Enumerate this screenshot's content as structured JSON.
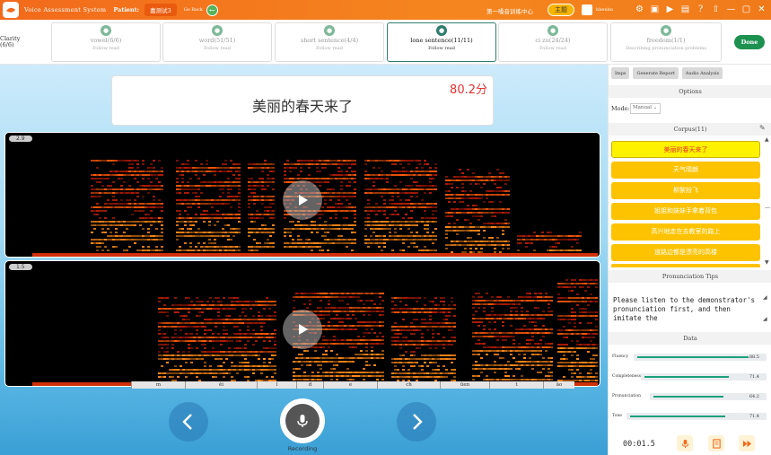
{
  "titlebar": {
    "app_title": "Voice Assessment System",
    "patient_label": "Patient:",
    "patient_name": "嘉测试3",
    "go_back": "Go Back",
    "center_name": "第一嗓音训练中心",
    "theme_button": "主题",
    "username": "bbenbu"
  },
  "clarity": {
    "label": "Clarity",
    "value": "(6/6)"
  },
  "tabs": [
    {
      "label": "vowel(6/6)",
      "sub": "Follow read"
    },
    {
      "label": "word(51/51)",
      "sub": "Follow read"
    },
    {
      "label": "short sentence(4/4)",
      "sub": "Follow read"
    },
    {
      "label": "lone sentence(11/11)",
      "sub": "Follow read"
    },
    {
      "label": "ci zu(24/24)",
      "sub": "Follow read"
    },
    {
      "label": "freedom(1/1)",
      "sub": "Describing pronunciation problems"
    }
  ],
  "done_button": "Done",
  "sentence": {
    "text": "美丽的春天来了",
    "score": "80.2分"
  },
  "spectrograms": [
    {
      "label": "2.9"
    },
    {
      "label": "1.5"
    }
  ],
  "phonemes": [
    "m",
    "ěi",
    "l",
    "d",
    "e",
    "ch",
    "ūen",
    "t",
    "āo"
  ],
  "recording_label": "Recording",
  "right_panel": {
    "buttons": [
      "Imps",
      "Generate Report",
      "Audio Analysis"
    ],
    "options_title": "Options",
    "mode_label": "Mode:",
    "mode_value": "Manual",
    "corpus_title": "Corpus(11)",
    "corpus_items": [
      "美丽的春天来了",
      "天气晴朗",
      "柳絮纷飞",
      "姐姐和妹妹手拿着背包",
      "高兴地走在去教室的路上",
      "道路边都是漂亮的高楼"
    ],
    "tips_title": "Pronunciation Tips",
    "tips_text": "Please listen to the demonstrator's pronunciation first, and then imitate the",
    "data_title": "Data",
    "metrics": [
      {
        "label": "Fluency",
        "value": "88.5",
        "level": 0.885
      },
      {
        "label": "Completeness",
        "value": "71.4",
        "level": 0.714
      },
      {
        "label": "Pronunciation",
        "value": "64.2",
        "level": 0.642
      },
      {
        "label": "Tone",
        "value": "71.4",
        "level": 0.714
      }
    ],
    "timer": "00:01.5"
  },
  "colors": {
    "accent": "#f5861f",
    "active_tab": "#2f7d6d",
    "corpus": "#fdc300",
    "done": "#1d9150",
    "score": "#e53030"
  }
}
